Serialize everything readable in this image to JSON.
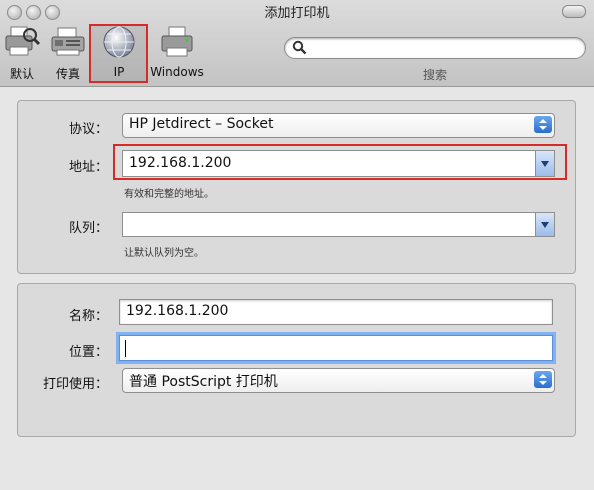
{
  "window": {
    "title": "添加打印机"
  },
  "toolbar": {
    "items": [
      {
        "label": "默认",
        "icon": "default-printer-icon"
      },
      {
        "label": "传真",
        "icon": "fax-icon"
      },
      {
        "label": "IP",
        "icon": "ip-globe-icon",
        "selected": true
      },
      {
        "label": "Windows",
        "icon": "windows-printer-icon"
      }
    ],
    "search": {
      "value": "",
      "placeholder": "",
      "label": "搜索"
    }
  },
  "connection": {
    "protocol": {
      "label": "协议：",
      "value": "HP Jetdirect – Socket"
    },
    "address": {
      "label": "地址：",
      "value": "192.168.1.200",
      "hint": "有效和完整的地址。"
    },
    "queue": {
      "label": "队列：",
      "value": "",
      "hint": "让默认队列为空。"
    }
  },
  "printer": {
    "name": {
      "label": "名称：",
      "value": "192.168.1.200"
    },
    "location": {
      "label": "位置：",
      "value": ""
    },
    "print_using": {
      "label": "打印使用：",
      "value": "普通 PostScript 打印机"
    }
  },
  "colors": {
    "highlight": "#d42b2b",
    "accent": "#2a6fd0",
    "focus_ring": "#7fb2ee"
  }
}
